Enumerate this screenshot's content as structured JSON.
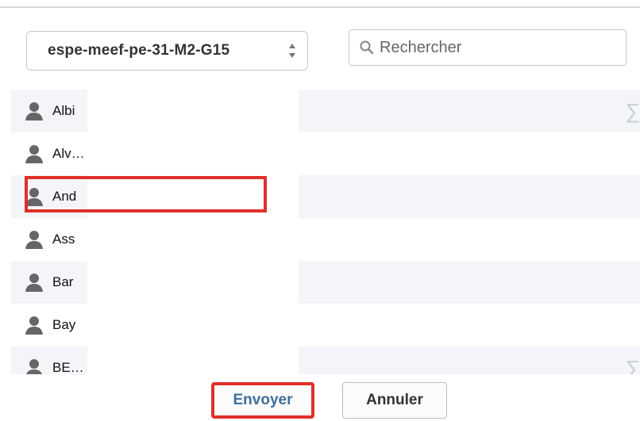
{
  "group_select": {
    "value": "espe-meef-pe-31-M2-G15"
  },
  "search": {
    "placeholder": "Rechercher"
  },
  "users": [
    {
      "name": "Albi",
      "sigma": "∑"
    },
    {
      "name": "Alv…",
      "sigma": ""
    },
    {
      "name": "And",
      "sigma": ""
    },
    {
      "name": "Ass",
      "sigma": ""
    },
    {
      "name": "Bar",
      "sigma": ""
    },
    {
      "name": "Bay",
      "sigma": ""
    },
    {
      "name": "BE…",
      "sigma": "∑"
    }
  ],
  "actions": {
    "send_label": "Envoyer",
    "cancel_label": "Annuler"
  },
  "colors": {
    "annotation_red": "#e0302b",
    "send_text": "#3f6f9a",
    "row_alt_bg": "#f3f5f8"
  },
  "icons": {
    "user": "person-icon",
    "search": "search-icon",
    "select_arrows": "updown-arrows-icon",
    "sum": "sigma-icon"
  }
}
